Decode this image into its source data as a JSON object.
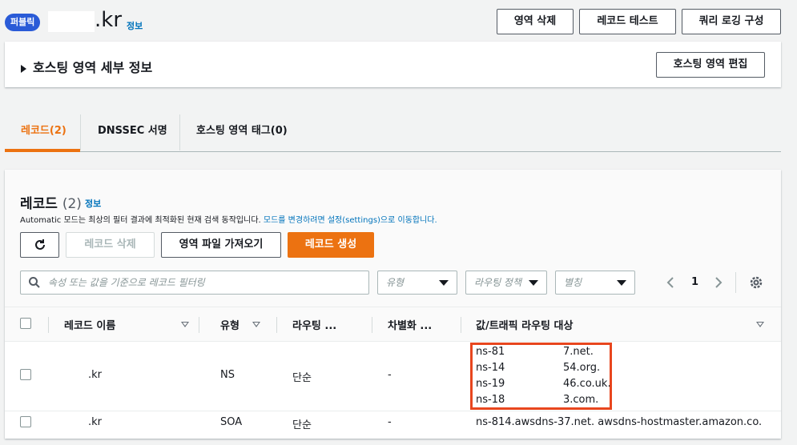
{
  "header": {
    "badge": "퍼블릭",
    "zone_suffix": ".kr",
    "info": "정보",
    "buttons": {
      "delete_zone": "영역 삭제",
      "test_record": "레코드 테스트",
      "query_logging": "쿼리 로깅 구성"
    }
  },
  "details": {
    "title": "호스팅 영역 세부 정보",
    "edit_button": "호스팅 영역 편집"
  },
  "tabs": [
    {
      "label": "레코드(2)",
      "active": true
    },
    {
      "label": "DNSSEC 서명",
      "active": false
    },
    {
      "label": "호스팅 영역 태그(0)",
      "active": false
    }
  ],
  "records": {
    "title": "레코드",
    "count": "(2)",
    "info": "정보",
    "description": "Automatic 모드는 최상의 필터 결과에 최적화된 현재 검색 동작입니다.",
    "settings_link": "모드를 변경하려면 설정(settings)으로 이동합니다.",
    "buttons": {
      "refresh_icon": "refresh-icon",
      "delete": "레코드 삭제",
      "import": "영역 파일 가져오기",
      "create": "레코드 생성"
    },
    "search_placeholder": "속성 또는 값을 기준으로 레코드 필터링",
    "filters": {
      "type": "유형",
      "routing": "라우팅 정책",
      "alias": "별칭"
    },
    "pagination": {
      "page": "1"
    },
    "columns": [
      "레코드 이름",
      "유형",
      "라우팅 ...",
      "차별화 ...",
      "값/트래픽 라우팅 대상"
    ],
    "rows": [
      {
        "name": ".kr",
        "type": "NS",
        "routing": "단순",
        "diff": "-",
        "values": [
          "ns-81",
          "7.net.",
          "ns-14",
          "54.org.",
          "ns-19",
          "46.co.uk.",
          "ns-18",
          "3.com."
        ]
      },
      {
        "name": ".kr",
        "type": "SOA",
        "routing": "단순",
        "diff": "-",
        "value": "ns-814.awsdns-37.net. awsdns-hostmaster.amazon.co..."
      }
    ],
    "highlight_color": "#e8461e"
  }
}
